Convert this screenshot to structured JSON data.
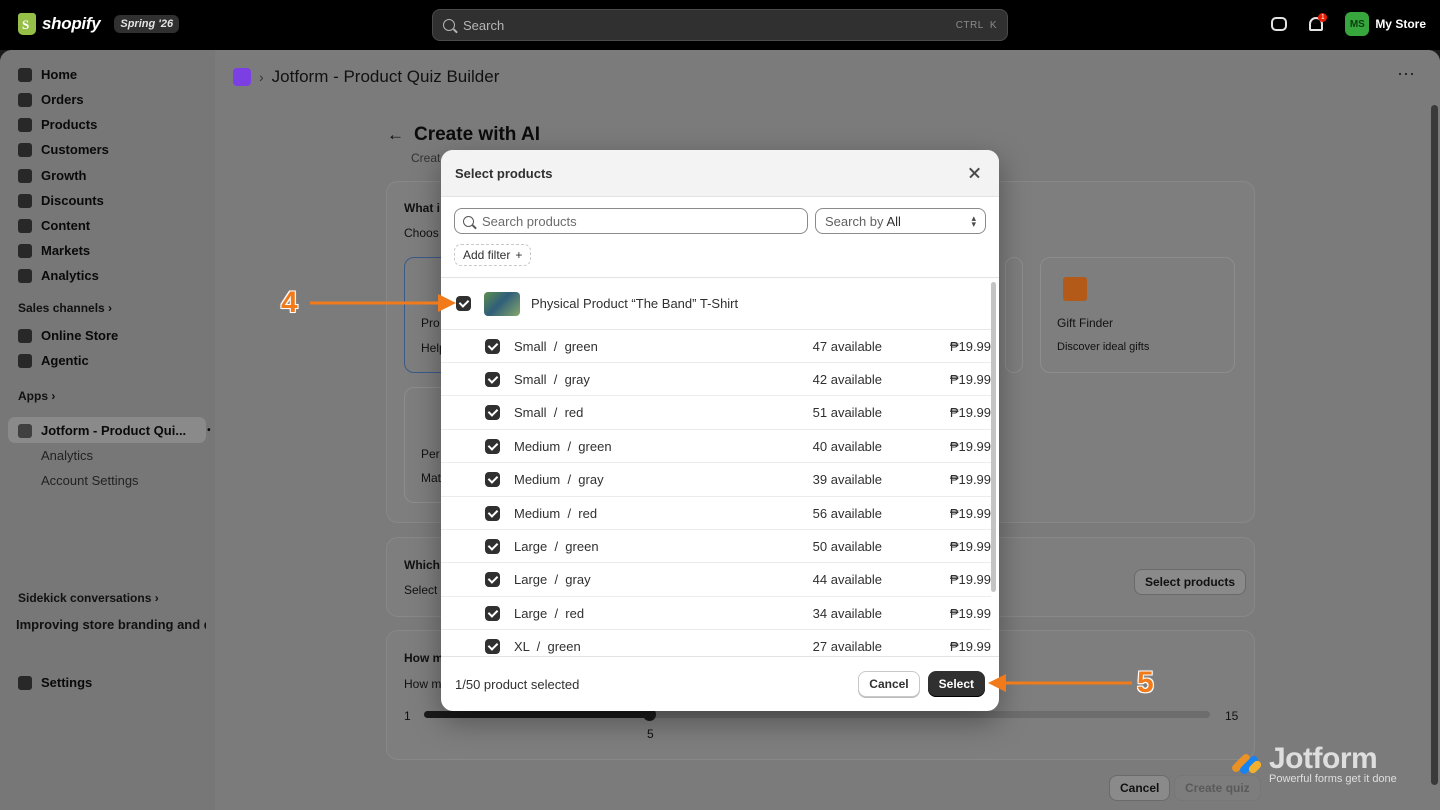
{
  "topbar": {
    "brand": "shopify",
    "edition": "Spring '26",
    "search_placeholder": "Search",
    "shortcut_ctrl": "CTRL",
    "shortcut_key": "K",
    "notification_count": "1",
    "store_initials": "MS",
    "store_name": "My Store"
  },
  "sidebar": {
    "items": [
      {
        "label": "Home",
        "icon": "home-icon"
      },
      {
        "label": "Orders",
        "icon": "orders-icon"
      },
      {
        "label": "Products",
        "icon": "tag-icon"
      },
      {
        "label": "Customers",
        "icon": "person-icon"
      },
      {
        "label": "Growth",
        "icon": "growth-icon"
      },
      {
        "label": "Discounts",
        "icon": "discount-icon"
      },
      {
        "label": "Content",
        "icon": "content-icon"
      },
      {
        "label": "Markets",
        "icon": "globe-icon"
      },
      {
        "label": "Analytics",
        "icon": "chart-icon"
      }
    ],
    "sales_channels_label": "Sales channels",
    "sales_channels": [
      {
        "label": "Online Store",
        "icon": "store-icon"
      },
      {
        "label": "Agentic",
        "icon": "agentic-icon"
      }
    ],
    "apps_label": "Apps",
    "app_active": "Jotform - Product Qui...",
    "app_sub": [
      "Analytics",
      "Account Settings"
    ],
    "sidekick_label": "Sidekick conversations",
    "sidekick_item": "Improving store branding and d...",
    "settings_label": "Settings"
  },
  "app_header": {
    "title": "Jotform - Product Quiz Builder",
    "more": "⋯"
  },
  "page": {
    "title": "Create with AI",
    "subtitle": "Creat",
    "q1_title": "What i",
    "q1_sub": "Choos",
    "tile1_title": "Pro",
    "tile1_sub": "Help",
    "tile2_title": "Per",
    "tile2_sub": "Mat",
    "gift_title": "Gift Finder",
    "gift_sub": "Discover ideal gifts",
    "q2_title": "Which",
    "q2_sub": "Select",
    "select_products_btn": "Select products",
    "q3_title": "How m",
    "q3_sub": "How m",
    "slider_min": "1",
    "slider_max": "15",
    "slider_value": "5",
    "slider_fraction": 0.2857,
    "cancel_btn": "Cancel",
    "create_btn": "Create quiz"
  },
  "modal": {
    "title": "Select products",
    "search_placeholder": "Search products",
    "search_by_label": "Search by",
    "search_by_value": "All",
    "add_filter": "Add filter",
    "add_filter_plus": "+",
    "product_name": "Physical Product “The Band” T-Shirt",
    "variants": [
      {
        "name": "Small  /  green",
        "available": "47 available",
        "price": "₱19.99"
      },
      {
        "name": "Small  /  gray",
        "available": "42 available",
        "price": "₱19.99"
      },
      {
        "name": "Small  /  red",
        "available": "51 available",
        "price": "₱19.99"
      },
      {
        "name": "Medium  /  green",
        "available": "40 available",
        "price": "₱19.99"
      },
      {
        "name": "Medium  /  gray",
        "available": "39 available",
        "price": "₱19.99"
      },
      {
        "name": "Medium  /  red",
        "available": "56 available",
        "price": "₱19.99"
      },
      {
        "name": "Large  /  green",
        "available": "50 available",
        "price": "₱19.99"
      },
      {
        "name": "Large  /  gray",
        "available": "44 available",
        "price": "₱19.99"
      },
      {
        "name": "Large  /  red",
        "available": "34 available",
        "price": "₱19.99"
      },
      {
        "name": "XL  /  green",
        "available": "27 available",
        "price": "₱19.99"
      }
    ],
    "selected_count": "1/50 product selected",
    "cancel": "Cancel",
    "select": "Select"
  },
  "annotations": {
    "step4": "4",
    "step5": "5",
    "arrow_color": "#f17b1b"
  },
  "watermark": {
    "name": "Jotform",
    "tagline": "Powerful forms get it done"
  }
}
